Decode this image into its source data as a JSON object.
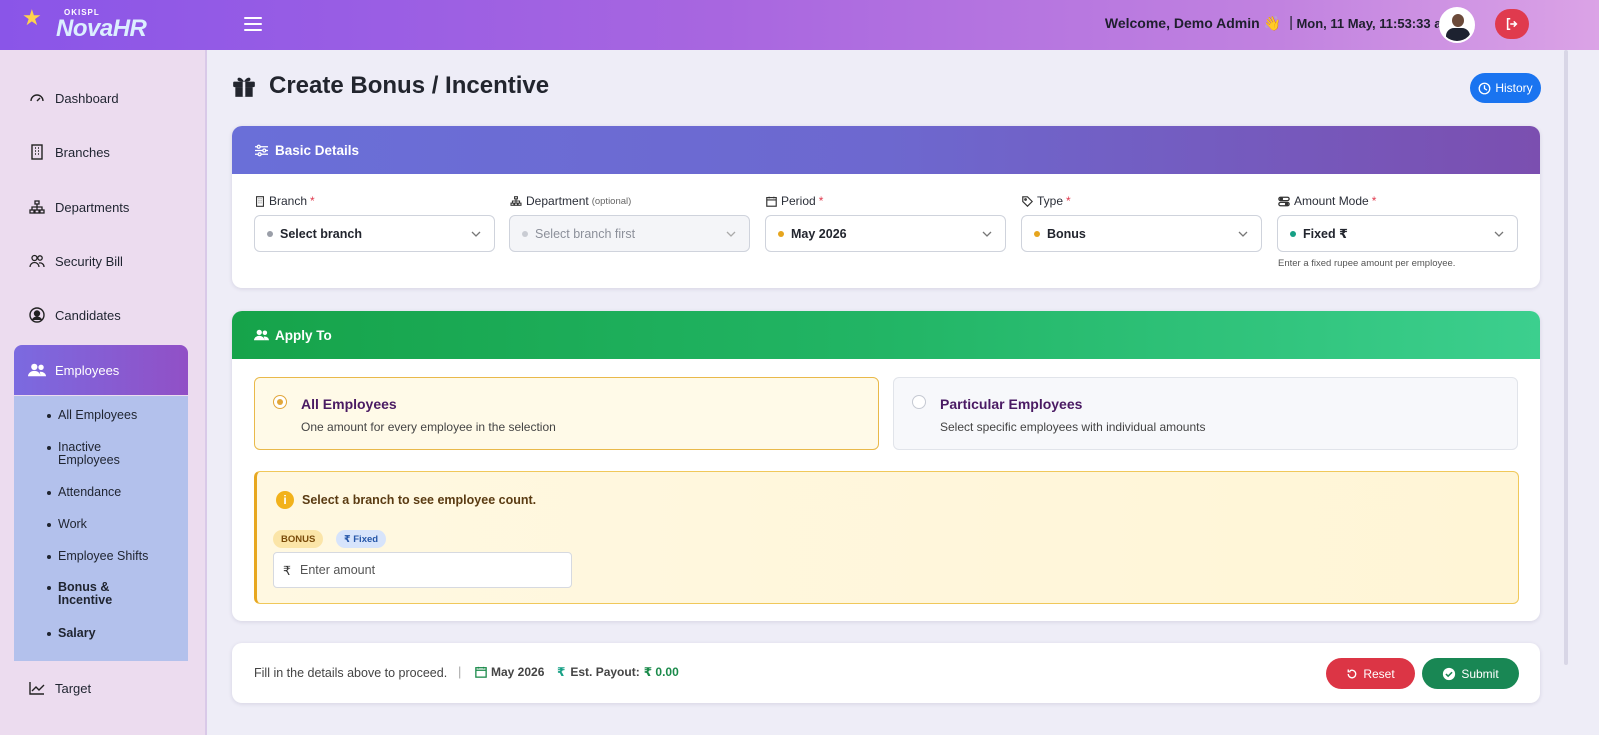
{
  "header": {
    "logo_small": "OKISPL",
    "logo_main": "NovaHR",
    "welcome": "Welcome, Demo Admin 👋",
    "separator": "|",
    "datetime": "Mon, 11 May, 11:53:33 am"
  },
  "sidebar": {
    "items": [
      {
        "label": "Dashboard",
        "icon": "dashboard-icon"
      },
      {
        "label": "Branches",
        "icon": "building-icon"
      },
      {
        "label": "Departments",
        "icon": "sitemap-icon"
      },
      {
        "label": "Security Bill",
        "icon": "users-icon"
      },
      {
        "label": "Candidates",
        "icon": "user-circle-icon"
      },
      {
        "label": "Employees",
        "icon": "user-group-icon"
      },
      {
        "label": "Target",
        "icon": "trend-icon"
      }
    ],
    "submenu": [
      "All Employees",
      "Inactive Employees",
      "Attendance",
      "Work",
      "Employee Shifts",
      "Bonus & Incentive",
      "Salary"
    ]
  },
  "page": {
    "title": "Create Bonus / Incentive",
    "history_label": "History"
  },
  "basic": {
    "heading": "Basic Details",
    "branch": {
      "label": "Branch",
      "value": "Select branch"
    },
    "department": {
      "label": "Department",
      "optional": "(optional)",
      "value": "Select branch first"
    },
    "period": {
      "label": "Period",
      "value": "May 2026"
    },
    "type": {
      "label": "Type",
      "value": "Bonus"
    },
    "amount_mode": {
      "label": "Amount Mode",
      "value": "Fixed ₹",
      "hint": "Enter a fixed rupee amount per employee."
    },
    "required_mark": "*"
  },
  "apply": {
    "heading": "Apply To",
    "all": {
      "title": "All Employees",
      "sub": "One amount for every employee in the selection"
    },
    "particular": {
      "title": "Particular Employees",
      "sub": "Select specific employees with individual amounts"
    },
    "notice": "Select a branch to see employee count.",
    "badge_type": "BONUS",
    "badge_mode": "₹ Fixed",
    "currency": "₹",
    "amount_placeholder": "Enter amount"
  },
  "footer": {
    "proceed": "Fill in the details above to proceed.",
    "pipe": "|",
    "period": "May 2026",
    "payout_label": "Est. Payout:",
    "payout_value": "₹ 0.00",
    "reset_label": "Reset",
    "submit_label": "Submit"
  },
  "colors": {
    "accent_purple": "#8a55e8",
    "basic_header": "#6a6fd8",
    "apply_header": "#16a34a",
    "reset": "#dc3545",
    "submit": "#198754",
    "history": "#1a74f0"
  }
}
